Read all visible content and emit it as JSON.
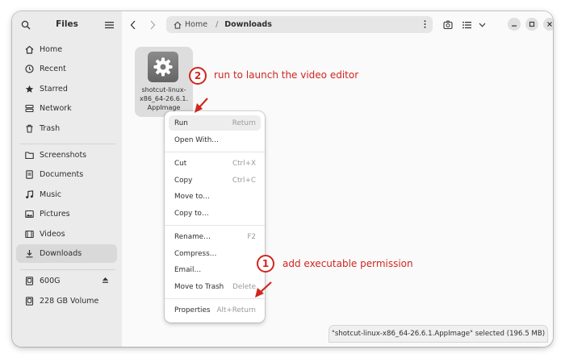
{
  "sidebar": {
    "title": "Files",
    "places": [
      {
        "label": "Home",
        "icon": "home-icon"
      },
      {
        "label": "Recent",
        "icon": "clock-icon"
      },
      {
        "label": "Starred",
        "icon": "star-icon"
      },
      {
        "label": "Network",
        "icon": "network-icon"
      },
      {
        "label": "Trash",
        "icon": "trash-icon"
      }
    ],
    "bookmarks": [
      {
        "label": "Screenshots",
        "icon": "folder-icon"
      },
      {
        "label": "Documents",
        "icon": "document-icon"
      },
      {
        "label": "Music",
        "icon": "music-icon"
      },
      {
        "label": "Pictures",
        "icon": "picture-icon"
      },
      {
        "label": "Videos",
        "icon": "video-icon"
      },
      {
        "label": "Downloads",
        "icon": "download-icon"
      }
    ],
    "devices": [
      {
        "label": "600G",
        "icon": "drive-icon"
      },
      {
        "label": "228 GB Volume",
        "icon": "drive-icon"
      }
    ]
  },
  "pathbar": {
    "home": "Home",
    "separator": "/",
    "current": "Downloads"
  },
  "file": {
    "name": "shotcut-linux-\nx86_64-26.6.1.\nAppImage"
  },
  "context_menu": {
    "items": [
      {
        "label": "Run",
        "accel": "Return"
      },
      {
        "label": "Open With…",
        "accel": ""
      },
      {
        "label": "Cut",
        "accel": "Ctrl+X"
      },
      {
        "label": "Copy",
        "accel": "Ctrl+C"
      },
      {
        "label": "Move to…",
        "accel": ""
      },
      {
        "label": "Copy to…",
        "accel": ""
      },
      {
        "label": "Rename…",
        "accel": "F2"
      },
      {
        "label": "Compress…",
        "accel": ""
      },
      {
        "label": "Email…",
        "accel": ""
      },
      {
        "label": "Move to Trash",
        "accel": "Delete"
      },
      {
        "label": "Properties",
        "accel": "Alt+Return"
      }
    ]
  },
  "annotations": {
    "step2": {
      "number": "2",
      "text": "run to launch the video editor"
    },
    "step1": {
      "number": "1",
      "text": "add executable permission"
    }
  },
  "status": "\"shotcut-linux-x86_64-26.6.1.AppImage\" selected  (196.5 MB)",
  "colors": {
    "accent": "#d0261f",
    "sidebar": "#ebebeb",
    "selected": "#d9d9d9"
  }
}
